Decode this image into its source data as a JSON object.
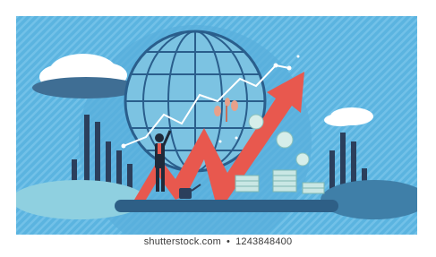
{
  "watermark": {
    "site": "shutterstock.com",
    "separator": "•",
    "image_number": "1243848400"
  },
  "colors": {
    "background_blue": "#5BB4E0",
    "stripe_blue": "#73C2E8",
    "globe_blue": "#6FB8DC",
    "globe_lines": "#2A5E8C",
    "arrow_red": "#E8584E",
    "bars_dark": "#2B3F5C",
    "cloud_white": "#FFFFFF",
    "cloud_grey": "#CFE4EE",
    "coins": "#C9E7E4"
  }
}
